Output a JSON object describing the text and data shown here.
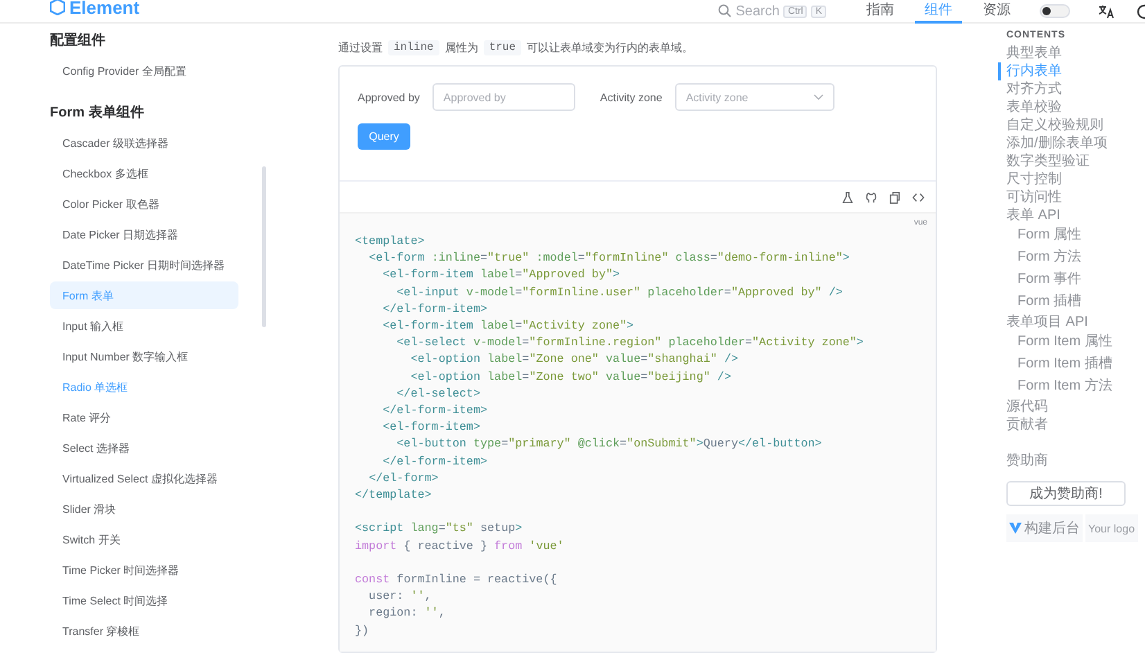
{
  "header": {
    "logo": "Element",
    "search": {
      "placeholder": "Search",
      "keys": [
        "Ctrl",
        "K"
      ]
    },
    "nav": [
      {
        "label": "指南",
        "selected": false
      },
      {
        "label": "组件",
        "selected": true
      },
      {
        "label": "资源",
        "selected": false
      }
    ],
    "dark_mode": false
  },
  "sidebar": {
    "groups": [
      {
        "title": "配置组件",
        "items": [
          {
            "label": "Config Provider 全局配置",
            "selected": false,
            "hovered": false
          }
        ]
      },
      {
        "title": "Form 表单组件",
        "items": [
          {
            "label": "Cascader 级联选择器",
            "selected": false,
            "hovered": false
          },
          {
            "label": "Checkbox 多选框",
            "selected": false,
            "hovered": false
          },
          {
            "label": "Color Picker 取色器",
            "selected": false,
            "hovered": false
          },
          {
            "label": "Date Picker 日期选择器",
            "selected": false,
            "hovered": false
          },
          {
            "label": "DateTime Picker 日期时间选择器",
            "selected": false,
            "hovered": false
          },
          {
            "label": "Form 表单",
            "selected": true,
            "hovered": false
          },
          {
            "label": "Input 输入框",
            "selected": false,
            "hovered": false
          },
          {
            "label": "Input Number 数字输入框",
            "selected": false,
            "hovered": false
          },
          {
            "label": "Radio 单选框",
            "selected": false,
            "hovered": true
          },
          {
            "label": "Rate 评分",
            "selected": false,
            "hovered": false
          },
          {
            "label": "Select 选择器",
            "selected": false,
            "hovered": false
          },
          {
            "label": "Virtualized Select 虚拟化选择器",
            "selected": false,
            "hovered": false
          },
          {
            "label": "Slider 滑块",
            "selected": false,
            "hovered": false
          },
          {
            "label": "Switch 开关",
            "selected": false,
            "hovered": false
          },
          {
            "label": "Time Picker 时间选择器",
            "selected": false,
            "hovered": false
          },
          {
            "label": "Time Select 时间选择",
            "selected": false,
            "hovered": false
          },
          {
            "label": "Transfer 穿梭框",
            "selected": false,
            "hovered": false
          }
        ]
      }
    ]
  },
  "intro": [
    {
      "kind": "text",
      "text": "通过设置"
    },
    {
      "kind": "code",
      "text": "inline"
    },
    {
      "kind": "text",
      "text": "属性为"
    },
    {
      "kind": "code",
      "text": "true"
    },
    {
      "kind": "text",
      "text": "可以让表单域变为行内的表单域。"
    }
  ],
  "demo": {
    "fields": [
      {
        "kind": "input",
        "label": "Approved by",
        "placeholder": "Approved by"
      },
      {
        "kind": "select",
        "label": "Activity zone",
        "placeholder": "Activity zone"
      }
    ],
    "button": "Query",
    "language": "vue",
    "code_blocks": [
      [
        "<template>",
        "  <el-form :inline=\"true\" :model=\"formInline\" class=\"demo-form-inline\">",
        "    <el-form-item label=\"Approved by\">",
        "      <el-input v-model=\"formInline.user\" placeholder=\"Approved by\" />",
        "    </el-form-item>",
        "    <el-form-item label=\"Activity zone\">",
        "      <el-select v-model=\"formInline.region\" placeholder=\"Activity zone\">",
        "        <el-option label=\"Zone one\" value=\"shanghai\" />",
        "        <el-option label=\"Zone two\" value=\"beijing\" />",
        "      </el-select>",
        "    </el-form-item>",
        "    <el-form-item>",
        "      <el-button type=\"primary\" @click=\"onSubmit\">Query</el-button>",
        "    </el-form-item>",
        "  </el-form>",
        "</template>"
      ],
      [
        "<script lang=\"ts\" setup>",
        "import { reactive } from 'vue'"
      ],
      [
        "const formInline = reactive({",
        "  user: '',",
        "  region: '',",
        "})"
      ]
    ]
  },
  "toc": {
    "title": "CONTENTS",
    "items": [
      {
        "label": "典型表单",
        "selected": false
      },
      {
        "label": "行内表单",
        "selected": true
      },
      {
        "label": "对齐方式",
        "selected": false
      },
      {
        "label": "表单校验",
        "selected": false
      },
      {
        "label": "自定义校验规则",
        "selected": false
      },
      {
        "label": "添加/删除表单项",
        "selected": false
      },
      {
        "label": "数字类型验证",
        "selected": false
      },
      {
        "label": "尺寸控制",
        "selected": false
      },
      {
        "label": "可访问性",
        "selected": false
      },
      {
        "label": "表单 API",
        "selected": false,
        "children": [
          {
            "label": "Form 属性",
            "selected": false
          },
          {
            "label": "Form 方法",
            "selected": false
          },
          {
            "label": "Form 事件",
            "selected": false
          },
          {
            "label": "Form 插槽",
            "selected": false
          }
        ]
      },
      {
        "label": "表单项目 API",
        "selected": false,
        "children": [
          {
            "label": "Form Item 属性",
            "selected": false
          },
          {
            "label": "Form Item 插槽",
            "selected": false
          },
          {
            "label": "Form Item 方法",
            "selected": false
          }
        ]
      },
      {
        "label": "源代码",
        "selected": false
      },
      {
        "label": "贡献者",
        "selected": false
      }
    ],
    "sponsors_title": "赞助商",
    "sponsor_button": "成为赞助商!",
    "sponsors": [
      "构建后台",
      "Your logo"
    ]
  }
}
